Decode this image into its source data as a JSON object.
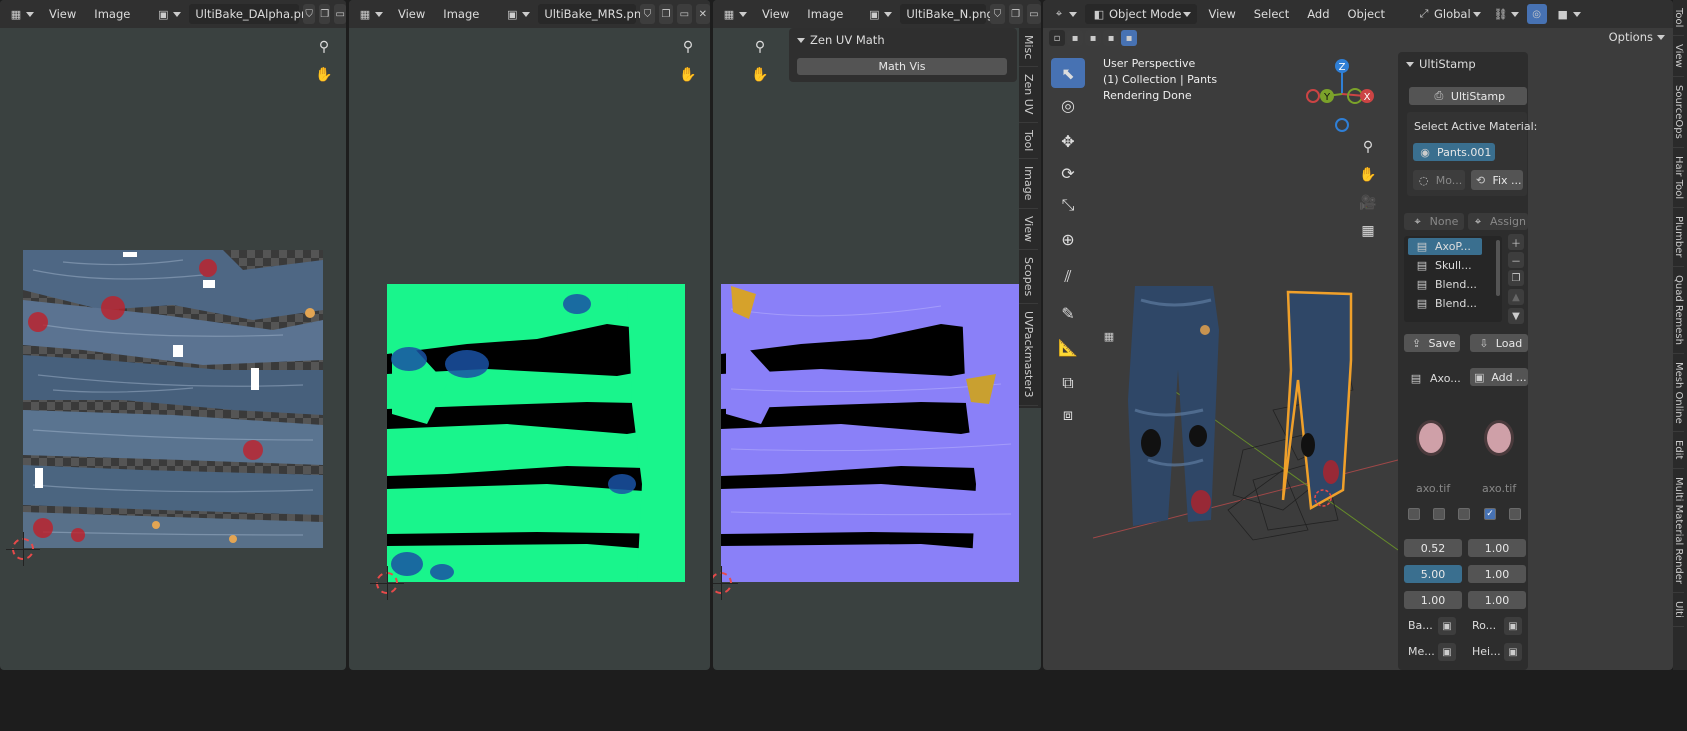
{
  "editors": [
    {
      "menus": [
        "View",
        "Image"
      ],
      "filename": "UltiBake_DAlpha.png"
    },
    {
      "menus": [
        "View",
        "Image"
      ],
      "filename": "UltiBake_MRS.png"
    },
    {
      "menus": [
        "View",
        "Image"
      ],
      "filename": "UltiBake_N.png"
    }
  ],
  "zen_panel": {
    "title": "Zen UV Math",
    "button": "Math Vis"
  },
  "image_sidebar_tabs": [
    "Misc",
    "Zen UV",
    "Tool",
    "Image",
    "View",
    "Scopes",
    "UVPackmaster3"
  ],
  "viewport": {
    "mode": "Object Mode",
    "menus": [
      "View",
      "Select",
      "Add",
      "Object"
    ],
    "orientation": "Global",
    "options": "Options",
    "overlay_lines": [
      "User Perspective",
      "(1) Collection | Pants",
      "Rendering Done"
    ],
    "gizmo_labels": {
      "z": "Z",
      "y": "Y",
      "x": "X"
    }
  },
  "ultistamp": {
    "panel_title": "UltiStamp",
    "main_button": "UltiStamp",
    "select_label": "Select Active Material:",
    "material": "Pants.001",
    "mo_button": "Mo...",
    "fix_button": "Fix ...",
    "none_button": "None",
    "assign_button": "Assign",
    "list_items": [
      "AxoP...",
      "Skull...",
      "Blend...",
      "Blend..."
    ],
    "save": "Save",
    "load": "Load",
    "axo_label": "Axo...",
    "add_button": "Add ...",
    "image_labels": [
      "axo.tif",
      "axo.tif"
    ],
    "values": [
      [
        "0.52",
        "1.00"
      ],
      [
        "5.00",
        "1.00"
      ],
      [
        "1.00",
        "1.00"
      ]
    ],
    "map_labels": [
      "Ba...",
      "Ro...",
      "Me...",
      "Hei..."
    ]
  },
  "viewport_sidebar_tabs": [
    "Tool",
    "View",
    "SourceOps",
    "Hair Tool",
    "Plumber",
    "Quad Remesh",
    "Mesh Online",
    "Edit",
    "Multi Material Render",
    "Ulti"
  ],
  "colors": {
    "accent": "#4772b3",
    "active_blue": "#3a6f8f",
    "selection_orange": "#f0a02a",
    "normal_map": "#8a80f8",
    "mrs_green": "#19f58c"
  }
}
